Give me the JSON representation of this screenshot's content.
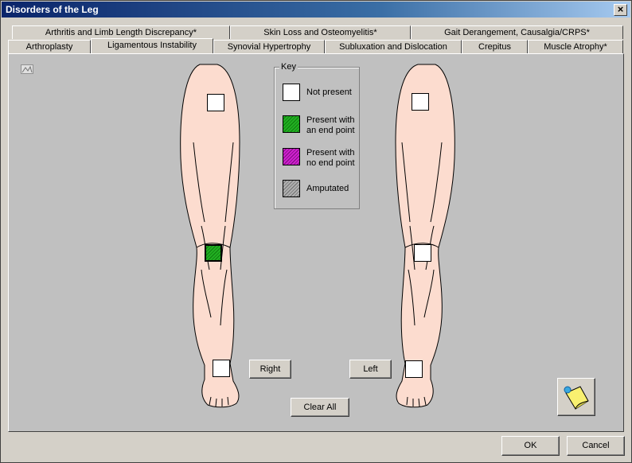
{
  "window": {
    "title": "Disorders of the Leg",
    "close_glyph": "×"
  },
  "tabs_row1": [
    {
      "label": "Arthritis and Limb Length Discrepancy*"
    },
    {
      "label": "Skin Loss and Osteomyelitis*"
    },
    {
      "label": "Gait Derangement, Causalgia/CRPS*"
    }
  ],
  "tabs_row2": [
    {
      "label": "Arthroplasty"
    },
    {
      "label": "Ligamentous Instability",
      "active": true
    },
    {
      "label": "Synovial Hypertrophy"
    },
    {
      "label": "Subluxation and Dislocation"
    },
    {
      "label": "Crepitus"
    },
    {
      "label": "Muscle Atrophy*"
    }
  ],
  "key": {
    "title": "Key",
    "items": [
      {
        "label": "Not present",
        "swatch": "white"
      },
      {
        "label": "Present with an end point",
        "swatch": "green"
      },
      {
        "label": "Present with no end point",
        "swatch": "magenta"
      },
      {
        "label": "Amputated",
        "swatch": "gray"
      }
    ]
  },
  "legs": {
    "right_button": "Right",
    "left_button": "Left",
    "right_markers": {
      "thigh": "not-present",
      "knee": "present-with-end-point",
      "ankle": "not-present"
    },
    "left_markers": {
      "thigh": "not-present",
      "knee": "not-present",
      "ankle": "not-present"
    }
  },
  "buttons": {
    "clear_all": "Clear All",
    "ok": "OK",
    "cancel": "Cancel"
  },
  "colors": {
    "skin": "#fcdccf",
    "green": "#22b022",
    "magenta": "#d020d0",
    "titlebar": "#0a246a"
  },
  "icons": {
    "notes": "sticky-note-icon",
    "small": "pattern-icon"
  }
}
